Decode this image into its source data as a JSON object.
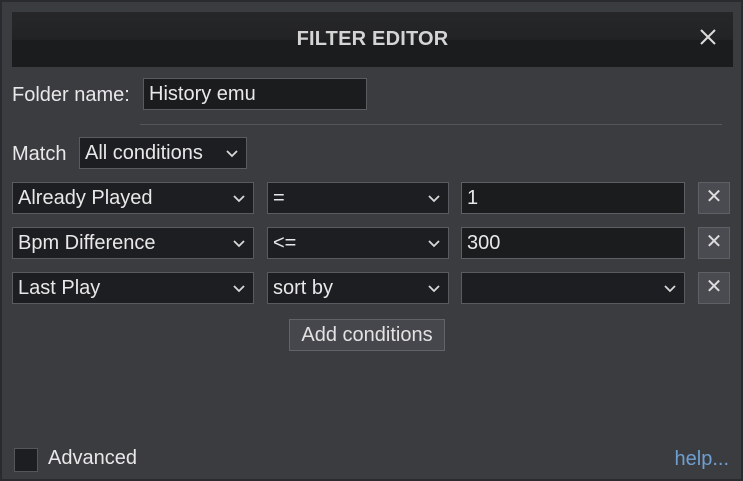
{
  "titlebar": {
    "title": "FILTER EDITOR",
    "close_icon": "close-icon"
  },
  "folder": {
    "label": "Folder name:",
    "value": "History emu"
  },
  "match": {
    "label": "Match",
    "selected": "All conditions"
  },
  "conditions": [
    {
      "field": "Already Played",
      "operator": "=",
      "value": "1",
      "value_is_select": false
    },
    {
      "field": "Bpm Difference",
      "operator": "<=",
      "value": "300",
      "value_is_select": false
    },
    {
      "field": "Last Play",
      "operator": "sort by",
      "value": "",
      "value_is_select": true
    }
  ],
  "delete_glyph": "✕",
  "add_conditions_label": "Add conditions",
  "advanced": {
    "label": "Advanced",
    "checked": false
  },
  "help_label": "help...",
  "colors": {
    "background": "#3b3c40",
    "titlebar": "#1f2022",
    "field": "#1d1e21",
    "link": "#6f9fd1"
  }
}
